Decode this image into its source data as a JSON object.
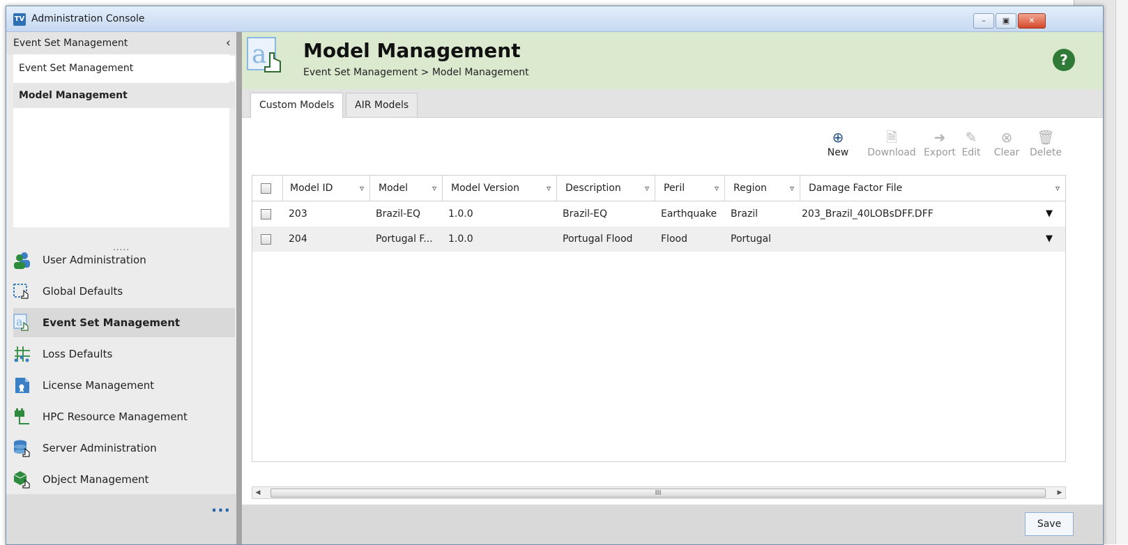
{
  "window": {
    "title": "Administration Console"
  },
  "sidebar": {
    "section_title": "Event Set Management",
    "sub_items": [
      {
        "label": "Event Set Management",
        "selected": false
      },
      {
        "label": "Model Management",
        "selected": true
      }
    ],
    "dots": ".....",
    "nav": [
      {
        "label": "User Administration",
        "icon": "users-icon"
      },
      {
        "label": "Global Defaults",
        "icon": "global-defaults-icon"
      },
      {
        "label": "Event Set Management",
        "icon": "event-set-icon",
        "selected": true
      },
      {
        "label": "Loss Defaults",
        "icon": "loss-defaults-icon"
      },
      {
        "label": "License Management",
        "icon": "license-icon"
      },
      {
        "label": "HPC Resource Management",
        "icon": "hpc-icon"
      },
      {
        "label": "Server Administration",
        "icon": "server-icon"
      },
      {
        "label": "Object Management",
        "icon": "object-icon"
      }
    ],
    "more": "..."
  },
  "header": {
    "title": "Model Management",
    "breadcrumb": "Event Set Management > Model Management",
    "help": "?"
  },
  "tabs": [
    {
      "label": "Custom Models",
      "active": true
    },
    {
      "label": "AIR Models",
      "active": false
    }
  ],
  "toolbar": [
    {
      "label": "New",
      "enabled": true,
      "icon": "plus-circle-icon"
    },
    {
      "label": "Download",
      "enabled": false,
      "icon": "download-icon"
    },
    {
      "label": "Export",
      "enabled": false,
      "icon": "export-icon"
    },
    {
      "label": "Edit",
      "enabled": false,
      "icon": "pencil-icon"
    },
    {
      "label": "Clear",
      "enabled": false,
      "icon": "clear-icon"
    },
    {
      "label": "Delete",
      "enabled": false,
      "icon": "trash-icon"
    }
  ],
  "table": {
    "columns": [
      "Model ID",
      "Model",
      "Model Version",
      "Description",
      "Peril",
      "Region",
      "Damage Factor File"
    ],
    "rows": [
      [
        "203",
        "Brazil-EQ",
        "1.0.0",
        "Brazil-EQ",
        "Earthquake",
        "Brazil",
        "203_Brazil_40LOBsDFF.DFF"
      ],
      [
        "204",
        "Portugal F...",
        "1.0.0",
        "Portugal Flood",
        "Flood",
        "Portugal",
        ""
      ]
    ],
    "scroll_grip": "III"
  },
  "footer": {
    "save_label": "Save"
  },
  "colors": {
    "header_bg": "#dbe9cf",
    "accent_blue": "#1f4f8b",
    "help_green": "#2f7a36"
  }
}
